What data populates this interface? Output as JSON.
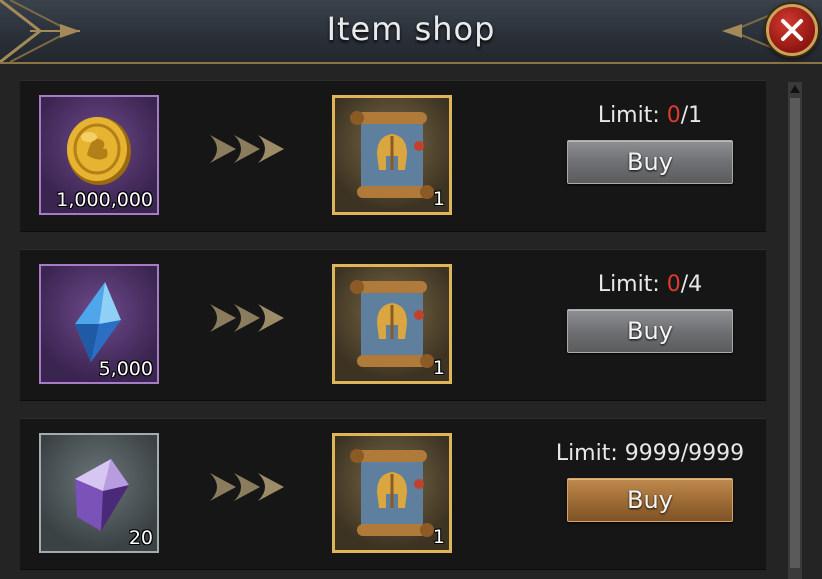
{
  "window": {
    "title": "Item shop",
    "close_icon": "close-x-icon"
  },
  "rows": [
    {
      "cost": {
        "icon": "gold-coin-icon",
        "amount": "1,000,000",
        "frame": "purple"
      },
      "reward": {
        "icon": "helmet-scroll-icon",
        "amount": "1"
      },
      "limit_label": "Limit: ",
      "limit_used": "0",
      "limit_total": "/1",
      "buy_label": "Buy",
      "buy_enabled": false
    },
    {
      "cost": {
        "icon": "blue-crystal-icon",
        "amount": "5,000",
        "frame": "purple"
      },
      "reward": {
        "icon": "helmet-scroll-icon",
        "amount": "1"
      },
      "limit_label": "Limit: ",
      "limit_used": "0",
      "limit_total": "/4",
      "buy_label": "Buy",
      "buy_enabled": false
    },
    {
      "cost": {
        "icon": "purple-gem-icon",
        "amount": "20",
        "frame": "grey"
      },
      "reward": {
        "icon": "helmet-scroll-icon",
        "amount": "1"
      },
      "limit_label": "Limit: ",
      "limit_used": "9999",
      "limit_total": "/9999",
      "buy_label": "Buy",
      "buy_enabled": true
    }
  ],
  "colors": {
    "limit_zero": "#e23a2a",
    "frame_gold": "#e0b55a",
    "button_active": "#9c6a34",
    "button_inactive": "#6c6e71"
  }
}
